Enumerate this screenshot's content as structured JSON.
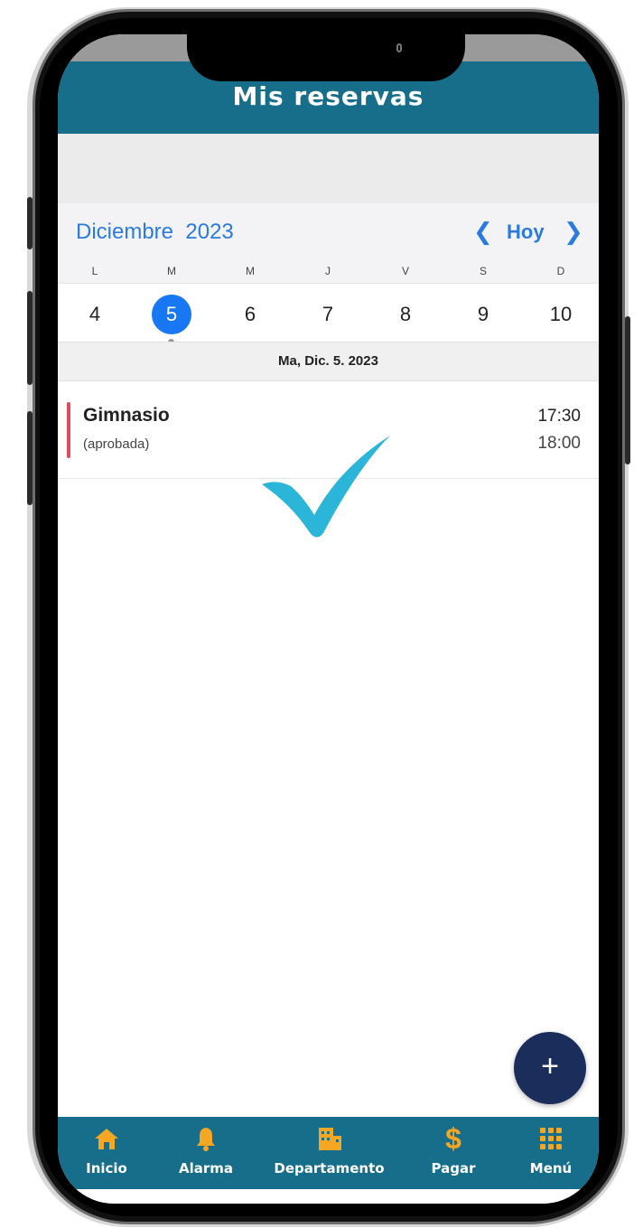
{
  "appbar": {
    "title": "Mis reservas"
  },
  "calendar": {
    "month": "Diciembre",
    "year": "2023",
    "today_label": "Hoy",
    "prev_icon": "chevron-left-icon",
    "next_icon": "chevron-right-icon",
    "weekdays": [
      "L",
      "M",
      "M",
      "J",
      "V",
      "S",
      "D"
    ],
    "days": [
      "4",
      "5",
      "6",
      "7",
      "8",
      "9",
      "10"
    ],
    "selected_day": "5",
    "selected_date_label": "Ma, Dic. 5. 2023"
  },
  "bookings": [
    {
      "title": "Gimnasio",
      "status": "(aprobada)",
      "start": "17:30",
      "end": "18:00"
    }
  ],
  "overlay": {
    "icon": "checkmark-icon",
    "color": "#2bb5d8"
  },
  "fab": {
    "label": "+",
    "icon": "plus-icon"
  },
  "bottom_nav": [
    {
      "label": "Inicio",
      "icon": "home-icon"
    },
    {
      "label": "Alarma",
      "icon": "bell-icon"
    },
    {
      "label": "Departamento",
      "icon": "building-icon"
    },
    {
      "label": "Pagar",
      "icon": "dollar-icon"
    },
    {
      "label": "Menú",
      "icon": "grid-icon"
    }
  ],
  "colors": {
    "appbar": "#166e8a",
    "accent": "#2b7bde",
    "selected_day": "#1877f2",
    "nav_icon": "#f5a623",
    "booking_bar": "#e04b5a",
    "fab": "#1b2d5a"
  }
}
